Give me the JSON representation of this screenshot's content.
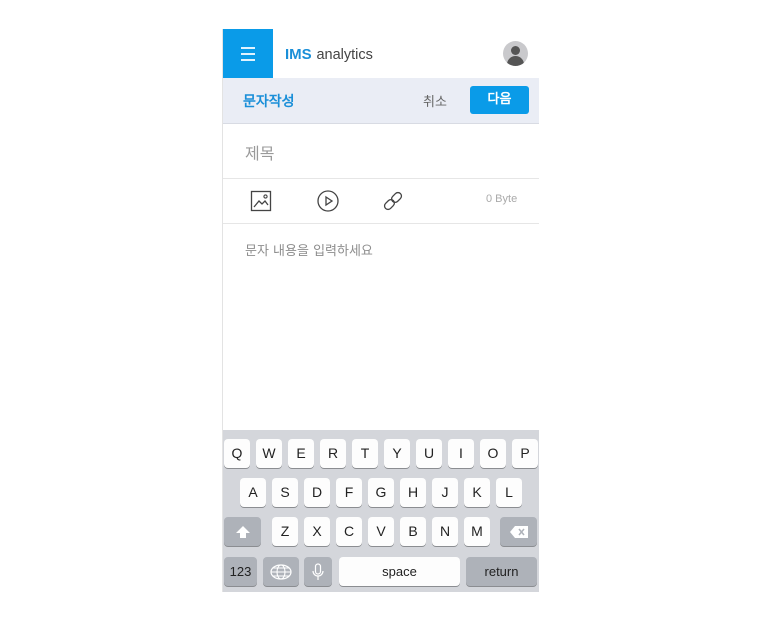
{
  "header": {
    "brand_bold": "IMS",
    "brand_rest": "analytics"
  },
  "subbar": {
    "title": "문자작성",
    "cancel_label": "취소",
    "next_label": "다음"
  },
  "form": {
    "title_placeholder": "제목",
    "byte_count": "0 Byte",
    "content_placeholder": "문자 내용을 입력하세요"
  },
  "keyboard": {
    "row1": [
      "Q",
      "W",
      "E",
      "R",
      "T",
      "Y",
      "U",
      "I",
      "O",
      "P"
    ],
    "row2": [
      "A",
      "S",
      "D",
      "F",
      "G",
      "H",
      "J",
      "K",
      "L"
    ],
    "row3": [
      "Z",
      "X",
      "C",
      "V",
      "B",
      "N",
      "M"
    ],
    "numbers_label": "123",
    "space_label": "space",
    "return_label": "return"
  },
  "colors": {
    "accent": "#0a9be8",
    "subbar_bg": "#eaedf5",
    "keyboard_bg": "#d4d6db"
  }
}
